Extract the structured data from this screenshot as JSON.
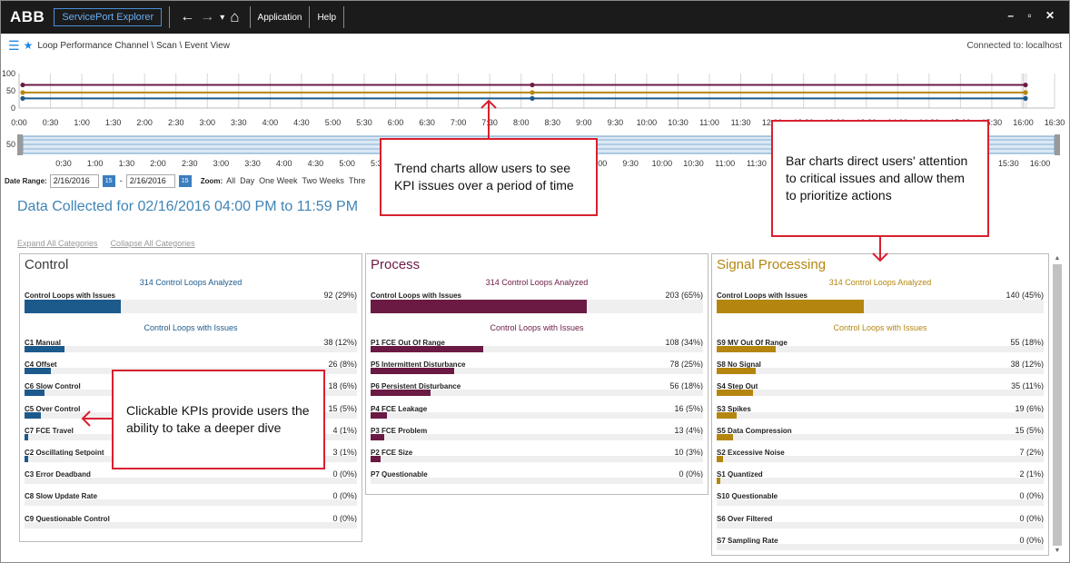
{
  "app": {
    "logo": "ABB",
    "name": "ServicePort Explorer",
    "nav": {
      "back": "←",
      "forward": "→",
      "dropdown": "▾",
      "home": "⌂"
    },
    "menus": [
      "Application",
      "Help"
    ],
    "window_controls": "– ▫ ✕"
  },
  "breadcrumb": {
    "path": "Loop Performance Channel \\ Scan \\ Event View",
    "connection": "Connected to: localhost"
  },
  "trend": {
    "y_ticks": [
      "100",
      "50",
      "0"
    ],
    "x_ticks": [
      "0:00",
      "0:30",
      "1:00",
      "1:30",
      "2:00",
      "2:30",
      "3:00",
      "3:30",
      "4:00",
      "4:30",
      "5:00",
      "5:30",
      "6:00",
      "6:30",
      "7:00",
      "7:30",
      "8:00",
      "8:30",
      "9:00",
      "9:30",
      "10:00",
      "10:30",
      "11:00",
      "11:30",
      "12:00",
      "12:30",
      "13:00",
      "13:30",
      "14:00",
      "14:30",
      "15:00",
      "15:30",
      "16:00",
      "16:30"
    ],
    "series": [
      {
        "color": "#6b1a44",
        "value": 67
      },
      {
        "color": "#b5860f",
        "value": 45
      },
      {
        "color": "#1c5a8c",
        "value": 28
      }
    ],
    "colors": {
      "grid": "#d6d6d6",
      "axis": "#bbbbbb",
      "highlight": "#eeeeee"
    }
  },
  "range_slider": {
    "mid_label": "50",
    "x_ticks": [
      "0:30",
      "1:00",
      "1:30",
      "2:00",
      "2:30",
      "3:00",
      "3:30",
      "4:00",
      "4:30",
      "5:00",
      "5:30",
      "6:00",
      "6:30",
      "7:00",
      "7:30",
      "8:00",
      "8:30",
      "9:00",
      "9:30",
      "10:00",
      "10:30",
      "11:00",
      "11:30",
      "12:00",
      "12:30",
      "13:00",
      "13:30",
      "14:00",
      "14:30",
      "15:00",
      "15:30",
      "16:00"
    ],
    "colors": {
      "band": "#dbe9f5",
      "border": "#6b9cc5",
      "handle": "#9a9a9a"
    }
  },
  "date_range": {
    "label": "Date Range:",
    "start": "2/16/2016",
    "separator": "-",
    "end": "2/16/2016",
    "calendar_icon": "15",
    "zoom_label": "Zoom:",
    "zoom_options": [
      "All",
      "Day",
      "One Week",
      "Two Weeks",
      "Thre"
    ]
  },
  "heading": "Data Collected for 02/16/2016 04:00 PM to 11:59 PM",
  "expand_all": "Expand All Categories",
  "collapse_all": "Collapse All Categories",
  "panels": [
    {
      "title": "Control",
      "title_color": "#3a3a3a",
      "accent": "#1c5a8c",
      "analyzed": "314 Control Loops Analyzed",
      "analyzed_color": "#1c5a8c",
      "summary": {
        "label": "Control Loops with Issues",
        "value": "92 (29%)",
        "fraction": 0.29
      },
      "subheading": "Control Loops with Issues",
      "kpis": [
        {
          "label": "C1 Manual",
          "value": "38 (12%)",
          "fraction": 0.12
        },
        {
          "label": "C4 Offset",
          "value": "26 (8%)",
          "fraction": 0.08
        },
        {
          "label": "C6 Slow Control",
          "value": "18 (6%)",
          "fraction": 0.06
        },
        {
          "label": "C5 Over Control",
          "value": "15 (5%)",
          "fraction": 0.05
        },
        {
          "label": "C7 FCE Travel",
          "value": "4 (1%)",
          "fraction": 0.01
        },
        {
          "label": "C2 Oscillating Setpoint",
          "value": "3 (1%)",
          "fraction": 0.01
        },
        {
          "label": "C3 Error Deadband",
          "value": "0 (0%)",
          "fraction": 0
        },
        {
          "label": "C8 Slow Update Rate",
          "value": "0 (0%)",
          "fraction": 0
        },
        {
          "label": "C9 Questionable Control",
          "value": "0 (0%)",
          "fraction": 0
        }
      ]
    },
    {
      "title": "Process",
      "title_color": "#6b1a44",
      "accent": "#6b1a44",
      "analyzed": "314 Control Loops Analyzed",
      "analyzed_color": "#6b1a44",
      "summary": {
        "label": "Control Loops with Issues",
        "value": "203 (65%)",
        "fraction": 0.65
      },
      "subheading": "Control Loops with Issues",
      "kpis": [
        {
          "label": "P1 FCE Out Of Range",
          "value": "108 (34%)",
          "fraction": 0.34
        },
        {
          "label": "P5 Intermittent Disturbance",
          "value": "78 (25%)",
          "fraction": 0.25
        },
        {
          "label": "P6 Persistent Disturbance",
          "value": "56 (18%)",
          "fraction": 0.18
        },
        {
          "label": "P4 FCE Leakage",
          "value": "16 (5%)",
          "fraction": 0.05
        },
        {
          "label": "P3 FCE Problem",
          "value": "13 (4%)",
          "fraction": 0.04
        },
        {
          "label": "P2 FCE Size",
          "value": "10 (3%)",
          "fraction": 0.03
        },
        {
          "label": "P7 Questionable",
          "value": "0 (0%)",
          "fraction": 0
        }
      ]
    },
    {
      "title": "Signal Processing",
      "title_color": "#b5860f",
      "accent": "#b5860f",
      "analyzed": "314 Control Loops Analyzed",
      "analyzed_color": "#b5860f",
      "summary": {
        "label": "Control Loops with Issues",
        "value": "140 (45%)",
        "fraction": 0.45
      },
      "subheading": "Control Loops with Issues",
      "kpis": [
        {
          "label": "S9 MV Out Of Range",
          "value": "55 (18%)",
          "fraction": 0.18
        },
        {
          "label": "S8 No Signal",
          "value": "38 (12%)",
          "fraction": 0.12
        },
        {
          "label": "S4 Step Out",
          "value": "35 (11%)",
          "fraction": 0.11
        },
        {
          "label": "S3 Spikes",
          "value": "19 (6%)",
          "fraction": 0.06
        },
        {
          "label": "S5 Data Compression",
          "value": "15 (5%)",
          "fraction": 0.05
        },
        {
          "label": "S2 Excessive Noise",
          "value": "7 (2%)",
          "fraction": 0.02
        },
        {
          "label": "S1 Quantized",
          "value": "2 (1%)",
          "fraction": 0.01
        },
        {
          "label": "S10 Questionable",
          "value": "0 (0%)",
          "fraction": 0
        },
        {
          "label": "S6 Over Filtered",
          "value": "0 (0%)",
          "fraction": 0
        },
        {
          "label": "S7 Sampling Rate",
          "value": "0 (0%)",
          "fraction": 0
        }
      ]
    }
  ],
  "callouts": {
    "trend": "Trend charts allow users to see KPI issues over a period of time",
    "bar": "Bar charts direct users' attention to critical issues and allow them to prioritize actions",
    "kpi": "Clickable KPIs provide users the ability to take a deeper dive"
  },
  "scrollbar": {
    "up": "▲",
    "down": "▼"
  },
  "colors": {
    "callout_border": "#d8202f",
    "accent_blue": "#1e88e5",
    "scroll_thumb": "#c2c2c2"
  }
}
